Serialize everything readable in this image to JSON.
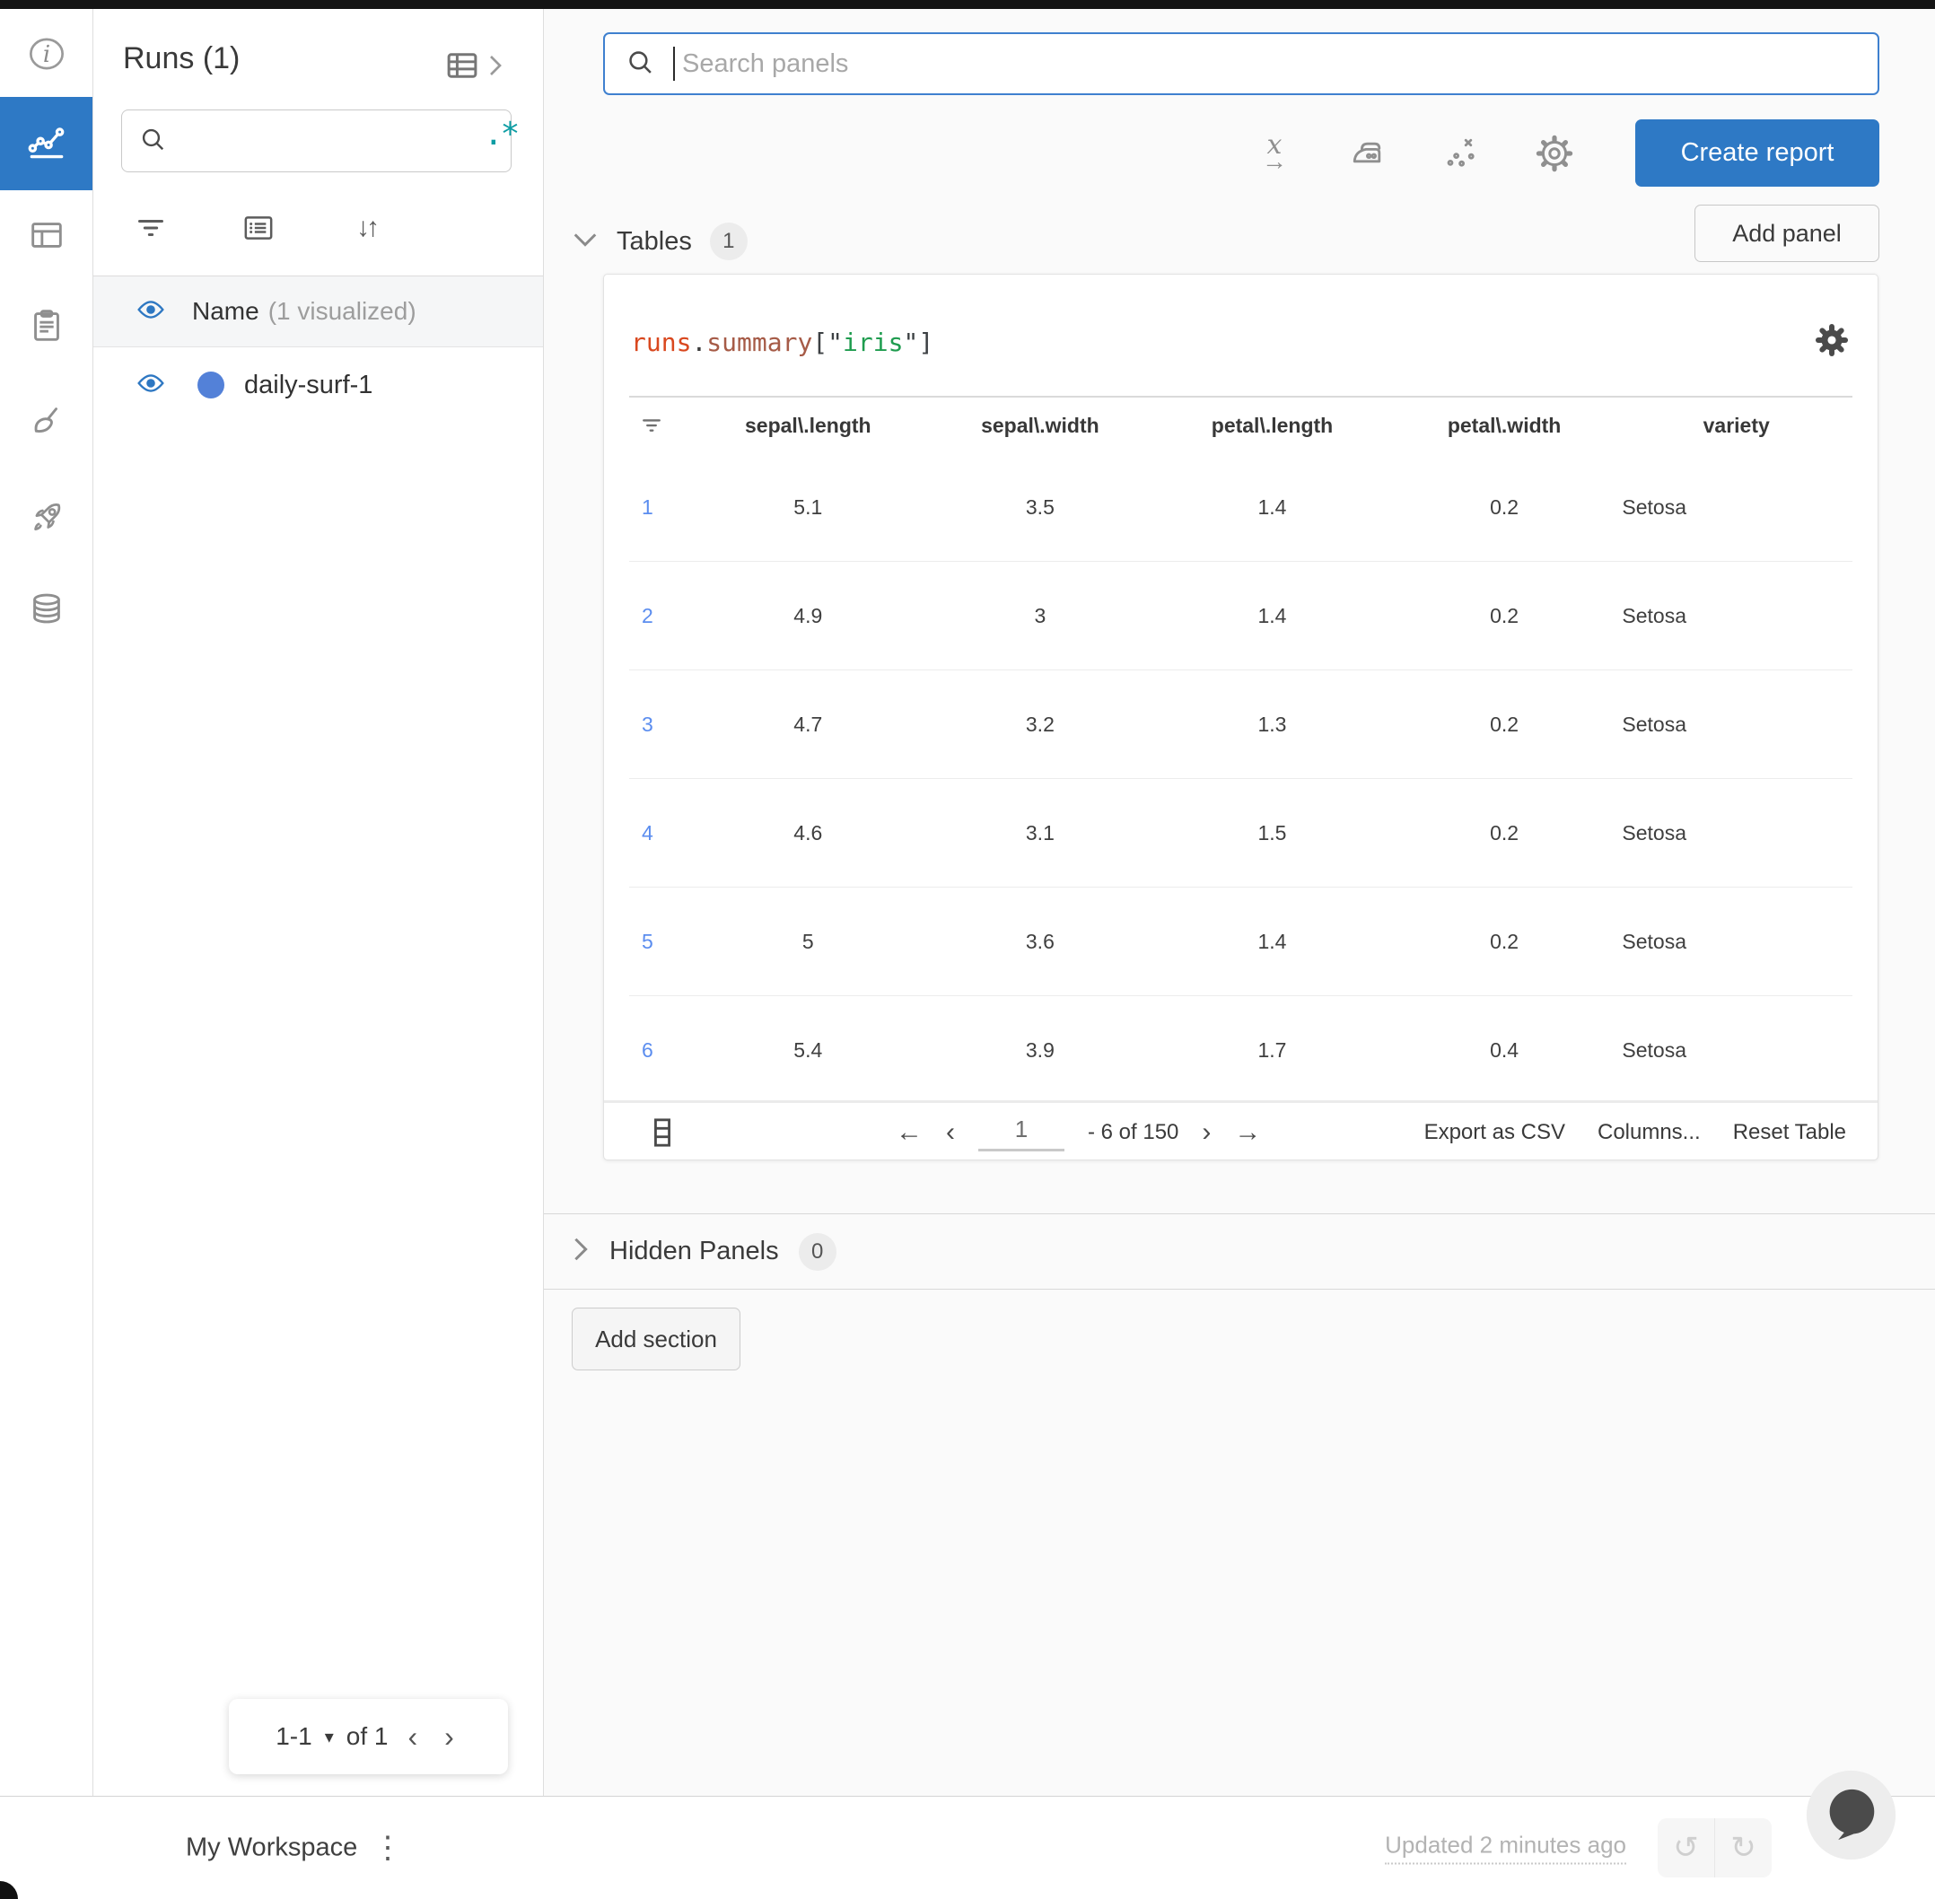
{
  "sidebar": {
    "title": "Runs (1)",
    "search": {
      "placeholder": ""
    },
    "name_row": {
      "label": "Name",
      "suffix": "(1 visualized)"
    },
    "runs": [
      {
        "name": "daily-surf-1"
      }
    ],
    "pagination": {
      "range": "1-1",
      "of": "of 1"
    }
  },
  "header": {
    "search_placeholder": "Search panels",
    "create_report": "Create report"
  },
  "sections": {
    "tables": {
      "label": "Tables",
      "count": "1",
      "add_panel": "Add panel"
    },
    "hidden_panels": {
      "label": "Hidden Panels",
      "count": "0"
    },
    "add_section": "Add section"
  },
  "panel": {
    "title": {
      "obj": "runs",
      "dot": ".",
      "attr": "summary",
      "open": "[\"",
      "key": "iris",
      "close": "\"]"
    },
    "columns": [
      "sepal\\.length",
      "sepal\\.width",
      "petal\\.length",
      "petal\\.width",
      "variety"
    ],
    "rows": [
      {
        "i": "1",
        "c0": "5.1",
        "c1": "3.5",
        "c2": "1.4",
        "c3": "0.2",
        "c4": "Setosa"
      },
      {
        "i": "2",
        "c0": "4.9",
        "c1": "3",
        "c2": "1.4",
        "c3": "0.2",
        "c4": "Setosa"
      },
      {
        "i": "3",
        "c0": "4.7",
        "c1": "3.2",
        "c2": "1.3",
        "c3": "0.2",
        "c4": "Setosa"
      },
      {
        "i": "4",
        "c0": "4.6",
        "c1": "3.1",
        "c2": "1.5",
        "c3": "0.2",
        "c4": "Setosa"
      },
      {
        "i": "5",
        "c0": "5",
        "c1": "3.6",
        "c2": "1.4",
        "c3": "0.2",
        "c4": "Setosa"
      },
      {
        "i": "6",
        "c0": "5.4",
        "c1": "3.9",
        "c2": "1.7",
        "c3": "0.4",
        "c4": "Setosa"
      }
    ],
    "footer": {
      "page": "1",
      "range": "- 6 of 150",
      "export": "Export as CSV",
      "columns": "Columns...",
      "reset": "Reset Table"
    }
  },
  "statusbar": {
    "workspace": "My Workspace",
    "updated": "Updated 2 minutes ago"
  },
  "icons": {
    "sort": "↓↑",
    "caret_down": "▾",
    "prev": "‹",
    "next": "›",
    "arrow_left": "←",
    "arrow_right": "→",
    "undo": "↺",
    "redo": "↻",
    "kebab": "⋮",
    "regex": ".*",
    "x_letter": "x"
  },
  "colors": {
    "accent_blue": "#2e79c5",
    "link_blue": "#5b8def",
    "run_dot_blue": "#5381d8",
    "code_object": "#d9481f",
    "code_attr": "#a65b47",
    "code_string": "#1f9c4f",
    "regex_teal": "#0d9da4"
  }
}
